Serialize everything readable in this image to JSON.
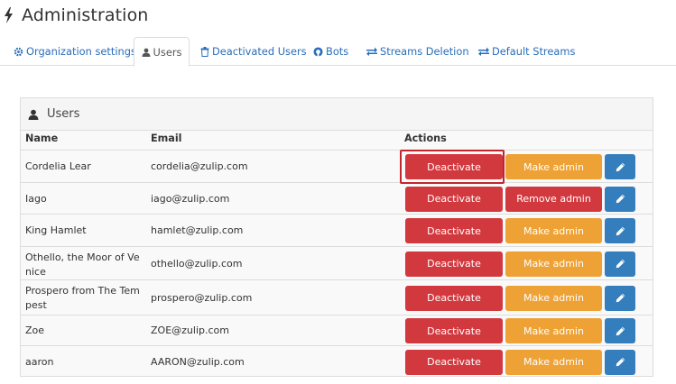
{
  "header": {
    "title": "Administration",
    "icon": "bolt-icon"
  },
  "tabs": [
    {
      "label": "Organization settings",
      "icon": "gear-icon"
    },
    {
      "label": "Users",
      "icon": "user-icon",
      "active": true
    },
    {
      "label": "Deactivated Users",
      "icon": "trash-icon"
    },
    {
      "label": "Bots",
      "icon": "github-icon"
    },
    {
      "label": "Streams Deletion",
      "icon": "exchange-icon"
    },
    {
      "label": "Default Streams",
      "icon": "exchange-icon"
    }
  ],
  "panel": {
    "title": "Users",
    "columns": {
      "name": "Name",
      "email": "Email",
      "actions": "Actions"
    },
    "labels": {
      "deactivate": "Deactivate",
      "make_admin": "Make admin",
      "remove_admin": "Remove admin"
    },
    "users": [
      {
        "name": "Cordelia Lear",
        "email": "cordelia@zulip.com",
        "admin_action": "Make admin"
      },
      {
        "name": "Iago",
        "email": "iago@zulip.com",
        "admin_action": "Remove admin"
      },
      {
        "name": "King Hamlet",
        "email": "hamlet@zulip.com",
        "admin_action": "Make admin"
      },
      {
        "name": "Othello, the Moor of Venice",
        "email": "othello@zulip.com",
        "admin_action": "Make admin"
      },
      {
        "name": "Prospero from The Tempest",
        "email": "prospero@zulip.com",
        "admin_action": "Make admin"
      },
      {
        "name": "Zoe",
        "email": "ZOE@zulip.com",
        "admin_action": "Make admin"
      },
      {
        "name": "aaron",
        "email": "AARON@zulip.com",
        "admin_action": "Make admin"
      }
    ]
  },
  "colors": {
    "link": "#2a6ebb",
    "danger": "#d1393f",
    "warning": "#eea236",
    "primary": "#357ebd",
    "focus": "#c0272d"
  }
}
